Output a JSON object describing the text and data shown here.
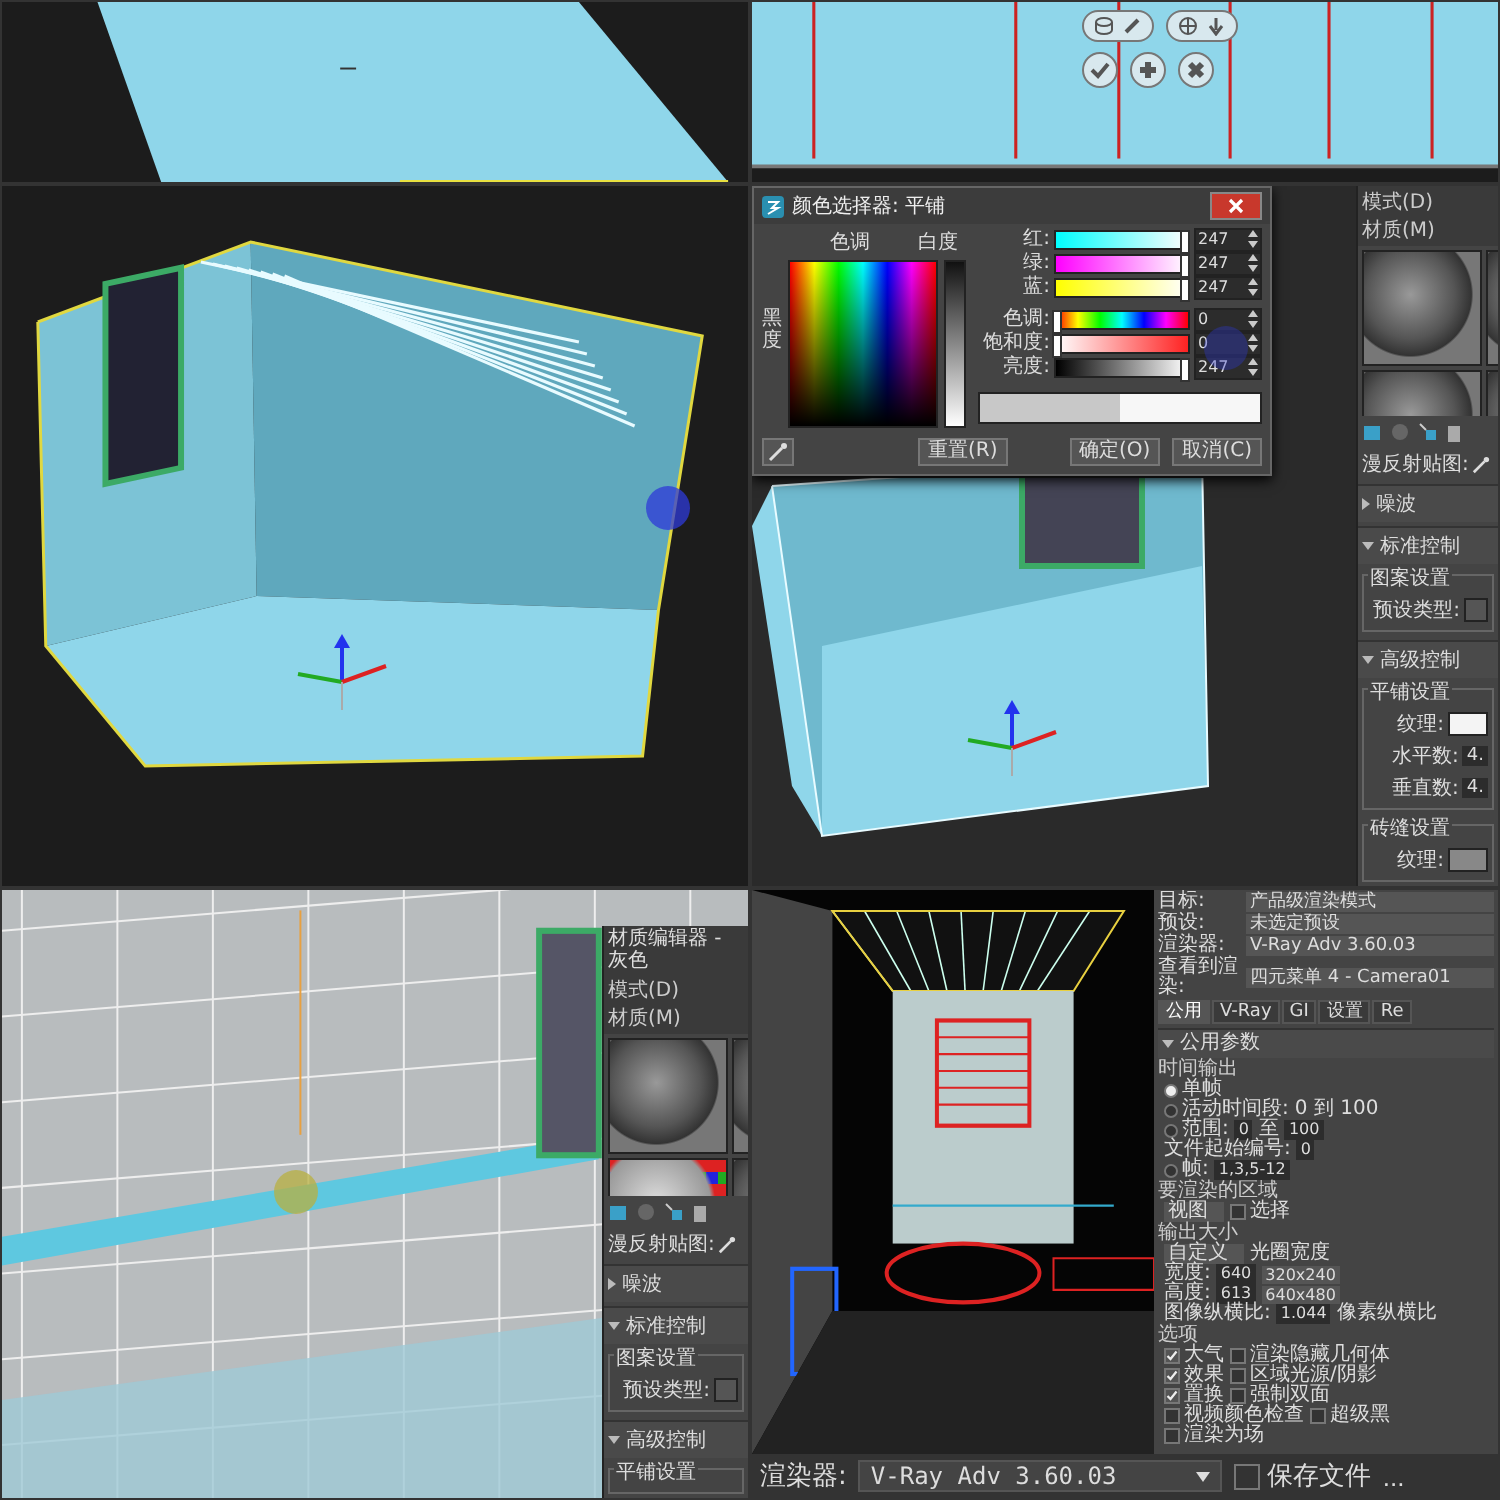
{
  "color_picker": {
    "title": "颜色选择器: 平铺",
    "hue_heading": "色调",
    "whiteness_heading": "白度",
    "blackness_label": "黑度",
    "rgb": [
      {
        "label": "红:",
        "value": "247",
        "level": 0.969,
        "kind": "red"
      },
      {
        "label": "绿:",
        "value": "247",
        "level": 0.969,
        "kind": "green"
      },
      {
        "label": "蓝:",
        "value": "247",
        "level": 0.969,
        "kind": "blue"
      }
    ],
    "hsv": [
      {
        "label": "色调:",
        "value": "0",
        "level": 0,
        "kind": "hue"
      },
      {
        "label": "饱和度:",
        "value": "0",
        "level": 0,
        "kind": "saturation"
      },
      {
        "label": "亮度:",
        "value": "247",
        "level": 0.969,
        "kind": "brightness"
      }
    ],
    "buttons": [
      {
        "label": "重置(R)",
        "kind": "reset"
      },
      {
        "label": "确定(O)",
        "kind": "ok"
      },
      {
        "label": "取消(C)",
        "kind": "cancel"
      }
    ]
  },
  "material_editor": {
    "menu": [
      "模式(D)",
      "材质(M)"
    ],
    "map_label": "漫反射贴图:",
    "rollouts": [
      {
        "title": "噪波",
        "expanded": false
      },
      {
        "title": "标准控制",
        "expanded": true,
        "groups": [
          {
            "title": "图案设置",
            "fields": [
              {
                "label": "预设类型:",
                "kind": "dropdown"
              }
            ]
          }
        ]
      },
      {
        "title": "高级控制",
        "expanded": true,
        "groups": [
          {
            "title": "平铺设置",
            "fields": [
              {
                "label": "纹理:",
                "kind": "swatch"
              },
              {
                "label": "水平数:",
                "kind": "input",
                "value": "4."
              },
              {
                "label": "垂直数:",
                "kind": "input",
                "value": "4."
              }
            ]
          },
          {
            "title": "砖缝设置",
            "fields": [
              {
                "label": "纹理:",
                "kind": "swatch"
              }
            ]
          }
        ]
      }
    ]
  },
  "mini_material_editor": {
    "title": "材质编辑器 - 灰色",
    "menu": [
      "模式(D)",
      "材质(M)"
    ],
    "map_label": "漫反射贴图:",
    "rollouts": [
      {
        "title": "噪波",
        "expanded": false
      },
      {
        "title": "标准控制",
        "expanded": true,
        "groups": [
          {
            "title": "图案设置",
            "fields": [
              {
                "label": "预设类型:",
                "kind": "dropdown"
              }
            ]
          }
        ]
      },
      {
        "title": "高级控制",
        "expanded": true,
        "groups": [
          {
            "title": "平铺设置"
          }
        ]
      }
    ]
  },
  "render_setup": {
    "fields": [
      {
        "label": "目标:",
        "value": "产品级渲染模式"
      },
      {
        "label": "预设:",
        "value": "未选定预设"
      },
      {
        "label": "渲染器:",
        "value": "V-Ray Adv 3.60.03"
      },
      {
        "label": "查看到渲染:",
        "value": "四元菜单 4 - Camera01"
      }
    ],
    "tabs": [
      {
        "label": "公用",
        "selected": true
      },
      {
        "label": "V-Ray",
        "selected": false
      },
      {
        "label": "GI",
        "selected": false
      },
      {
        "label": "设置",
        "selected": false
      },
      {
        "label": "Re",
        "selected": false
      }
    ],
    "rollout": "公用参数",
    "rows": [
      {
        "kind": "group",
        "label": "时间输出"
      },
      {
        "cells": [
          {
            "kind": "radio",
            "label": "单帧",
            "selected": true
          }
        ]
      },
      {
        "cells": [
          {
            "kind": "radio",
            "label": "活动时间段:",
            "selected": false
          },
          {
            "kind": "text",
            "label": "0 到 100"
          }
        ]
      },
      {
        "cells": [
          {
            "kind": "radio",
            "label": "范围:",
            "selected": false
          },
          {
            "kind": "input",
            "value": "0"
          },
          {
            "kind": "text",
            "label": "至"
          },
          {
            "kind": "input",
            "value": "100"
          }
        ]
      },
      {
        "cells": [
          {
            "kind": "text",
            "label": "文件起始编号:"
          },
          {
            "kind": "input",
            "value": "0"
          }
        ]
      },
      {
        "cells": [
          {
            "kind": "radio",
            "label": "帧:",
            "selected": false
          },
          {
            "kind": "input",
            "value": "1,3,5-12"
          }
        ]
      },
      {
        "kind": "group",
        "label": "要渲染的区域"
      },
      {
        "cells": [
          {
            "kind": "dropdown",
            "value": "视图"
          },
          {
            "kind": "check",
            "label": "选择",
            "checked": false
          }
        ]
      },
      {
        "kind": "group",
        "label": "输出大小"
      },
      {
        "cells": [
          {
            "kind": "dropdown",
            "value": "自定义"
          },
          {
            "kind": "text",
            "label": "光圈宽度"
          }
        ]
      },
      {
        "cells": [
          {
            "kind": "text",
            "label": "宽度:"
          },
          {
            "kind": "input",
            "value": "640"
          },
          {
            "kind": "button",
            "label": "320x240"
          }
        ]
      },
      {
        "cells": [
          {
            "kind": "text",
            "label": "高度:"
          },
          {
            "kind": "input",
            "value": "613"
          },
          {
            "kind": "button",
            "label": "640x480"
          }
        ]
      },
      {
        "cells": [
          {
            "kind": "text",
            "label": "图像纵横比:"
          },
          {
            "kind": "input",
            "value": "1.044"
          },
          {
            "kind": "text",
            "label": "像素纵横比"
          }
        ]
      },
      {
        "kind": "group",
        "label": "选项"
      },
      {
        "cells": [
          {
            "kind": "check",
            "label": "大气",
            "checked": true
          },
          {
            "kind": "check",
            "label": "渲染隐藏几何体",
            "checked": false
          }
        ]
      },
      {
        "cells": [
          {
            "kind": "check",
            "label": "效果",
            "checked": true
          },
          {
            "kind": "check",
            "label": "区域光源/阴影",
            "checked": false
          }
        ]
      },
      {
        "cells": [
          {
            "kind": "check",
            "label": "置换",
            "checked": true
          },
          {
            "kind": "check",
            "label": "强制双面",
            "checked": false
          }
        ]
      },
      {
        "cells": [
          {
            "kind": "check",
            "label": "视频颜色检查",
            "checked": false
          },
          {
            "kind": "check",
            "label": "超级黑",
            "checked": false
          }
        ]
      },
      {
        "cells": [
          {
            "kind": "check",
            "label": "渲染为场",
            "checked": false
          }
        ]
      }
    ]
  },
  "bottom_bar": {
    "label": "渲染器:",
    "value": "V-Ray Adv 3.60.03",
    "save_file": {
      "label": "保存文件",
      "checked": false
    },
    "more": "..."
  }
}
